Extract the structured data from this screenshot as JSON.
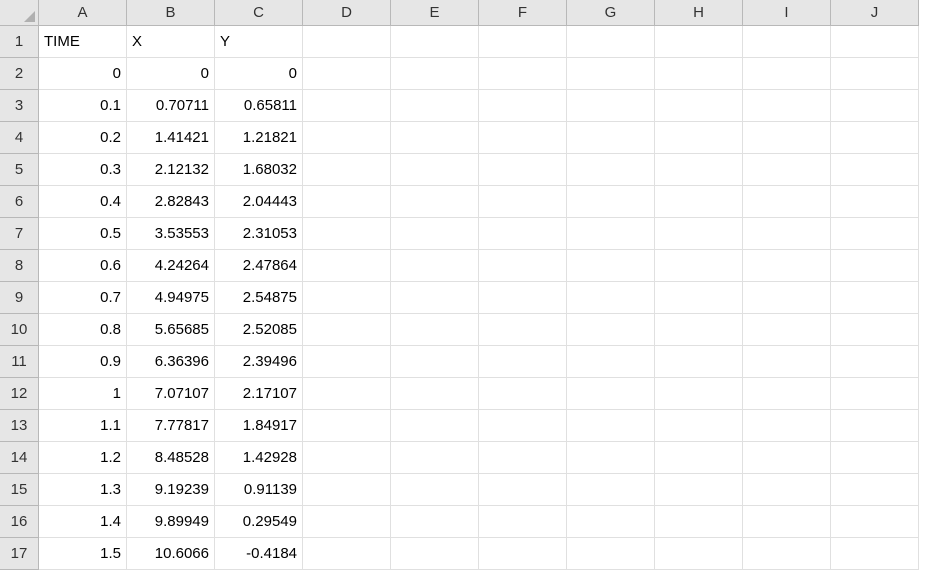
{
  "columns": [
    "A",
    "B",
    "C",
    "D",
    "E",
    "F",
    "G",
    "H",
    "I",
    "J"
  ],
  "rowCount": 17,
  "headerRow": {
    "A": "TIME",
    "B": "X",
    "C": "Y"
  },
  "dataRows": [
    {
      "A": "0",
      "B": "0",
      "C": "0"
    },
    {
      "A": "0.1",
      "B": "0.70711",
      "C": "0.65811"
    },
    {
      "A": "0.2",
      "B": "1.41421",
      "C": "1.21821"
    },
    {
      "A": "0.3",
      "B": "2.12132",
      "C": "1.68032"
    },
    {
      "A": "0.4",
      "B": "2.82843",
      "C": "2.04443"
    },
    {
      "A": "0.5",
      "B": "3.53553",
      "C": "2.31053"
    },
    {
      "A": "0.6",
      "B": "4.24264",
      "C": "2.47864"
    },
    {
      "A": "0.7",
      "B": "4.94975",
      "C": "2.54875"
    },
    {
      "A": "0.8",
      "B": "5.65685",
      "C": "2.52085"
    },
    {
      "A": "0.9",
      "B": "6.36396",
      "C": "2.39496"
    },
    {
      "A": "1",
      "B": "7.07107",
      "C": "2.17107"
    },
    {
      "A": "1.1",
      "B": "7.77817",
      "C": "1.84917"
    },
    {
      "A": "1.2",
      "B": "8.48528",
      "C": "1.42928"
    },
    {
      "A": "1.3",
      "B": "9.19239",
      "C": "0.91139"
    },
    {
      "A": "1.4",
      "B": "9.89949",
      "C": "0.29549"
    },
    {
      "A": "1.5",
      "B": "10.6066",
      "C": "-0.4184"
    }
  ]
}
